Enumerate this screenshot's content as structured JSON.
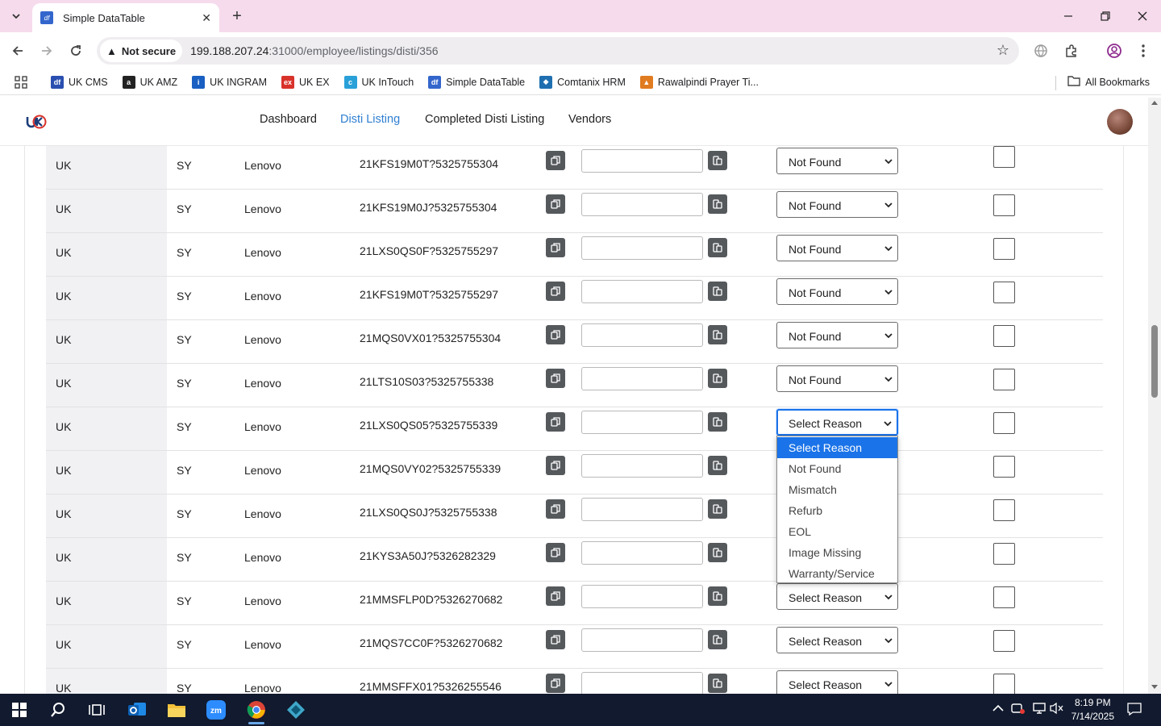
{
  "browser": {
    "tab_title": "Simple DataTable",
    "tab_favicon": "df",
    "security_label": "Not secure",
    "url_host": "199.188.207.24",
    "url_rest": ":31000/employee/listings/disti/356",
    "bookmarks": [
      {
        "label": "UK CMS",
        "icon": "df",
        "color": "#2a4fb0"
      },
      {
        "label": "UK AMZ",
        "icon": "a",
        "color": "#222222"
      },
      {
        "label": "UK INGRAM",
        "icon": "i",
        "color": "#1a5fc2"
      },
      {
        "label": "UK EX",
        "icon": "ex",
        "color": "#d8322a"
      },
      {
        "label": "UK InTouch",
        "icon": "c",
        "color": "#29a0d8"
      },
      {
        "label": "Simple DataTable",
        "icon": "df",
        "color": "#3366cc"
      },
      {
        "label": "Comtanix HRM",
        "icon": "◆",
        "color": "#1f6fb0"
      },
      {
        "label": "Rawalpindi Prayer Ti...",
        "icon": "▲",
        "color": "#e07b20"
      }
    ],
    "all_bookmarks": "All Bookmarks"
  },
  "nav": {
    "links": [
      "Dashboard",
      "Disti Listing",
      "Completed Disti Listing",
      "Vendors"
    ],
    "active": "Disti Listing"
  },
  "rows": [
    {
      "country": "UK",
      "code": "SY",
      "brand": "Lenovo",
      "sku": "21KFS19M0T?5325755304",
      "reason": "Not Found"
    },
    {
      "country": "UK",
      "code": "SY",
      "brand": "Lenovo",
      "sku": "21KFS19M0J?5325755304",
      "reason": "Not Found"
    },
    {
      "country": "UK",
      "code": "SY",
      "brand": "Lenovo",
      "sku": "21LXS0QS0F?5325755297",
      "reason": "Not Found"
    },
    {
      "country": "UK",
      "code": "SY",
      "brand": "Lenovo",
      "sku": "21KFS19M0T?5325755297",
      "reason": "Not Found"
    },
    {
      "country": "UK",
      "code": "SY",
      "brand": "Lenovo",
      "sku": "21MQS0VX01?5325755304",
      "reason": "Not Found"
    },
    {
      "country": "UK",
      "code": "SY",
      "brand": "Lenovo",
      "sku": "21LTS10S03?5325755338",
      "reason": "Not Found"
    },
    {
      "country": "UK",
      "code": "SY",
      "brand": "Lenovo",
      "sku": "21LXS0QS05?5325755339",
      "reason": "Select Reason",
      "focused": true
    },
    {
      "country": "UK",
      "code": "SY",
      "brand": "Lenovo",
      "sku": "21MQS0VY02?5325755339",
      "reason": ""
    },
    {
      "country": "UK",
      "code": "SY",
      "brand": "Lenovo",
      "sku": "21LXS0QS0J?5325755338",
      "reason": ""
    },
    {
      "country": "UK",
      "code": "SY",
      "brand": "Lenovo",
      "sku": "21KYS3A50J?5326282329",
      "reason": ""
    },
    {
      "country": "UK",
      "code": "SY",
      "brand": "Lenovo",
      "sku": "21MMSFLP0D?5326270682",
      "reason": "Select Reason"
    },
    {
      "country": "UK",
      "code": "SY",
      "brand": "Lenovo",
      "sku": "21MQS7CC0F?5326270682",
      "reason": "Select Reason"
    },
    {
      "country": "UK",
      "code": "SY",
      "brand": "Lenovo",
      "sku": "21MMSFFX01?5326255546",
      "reason": "Select Reason"
    }
  ],
  "dropdown_options": [
    "Select Reason",
    "Not Found",
    "Mismatch",
    "Refurb",
    "EOL",
    "Image Missing",
    "Warranty/Service"
  ],
  "dropdown_selected": "Select Reason",
  "taskbar": {
    "time": "8:19 PM",
    "date": "7/14/2025"
  },
  "colors": {
    "tabstrip": "#f6dbed",
    "accent": "#1a73e8",
    "nav_active": "#2f7fd0",
    "copy_button": "#55595c"
  }
}
